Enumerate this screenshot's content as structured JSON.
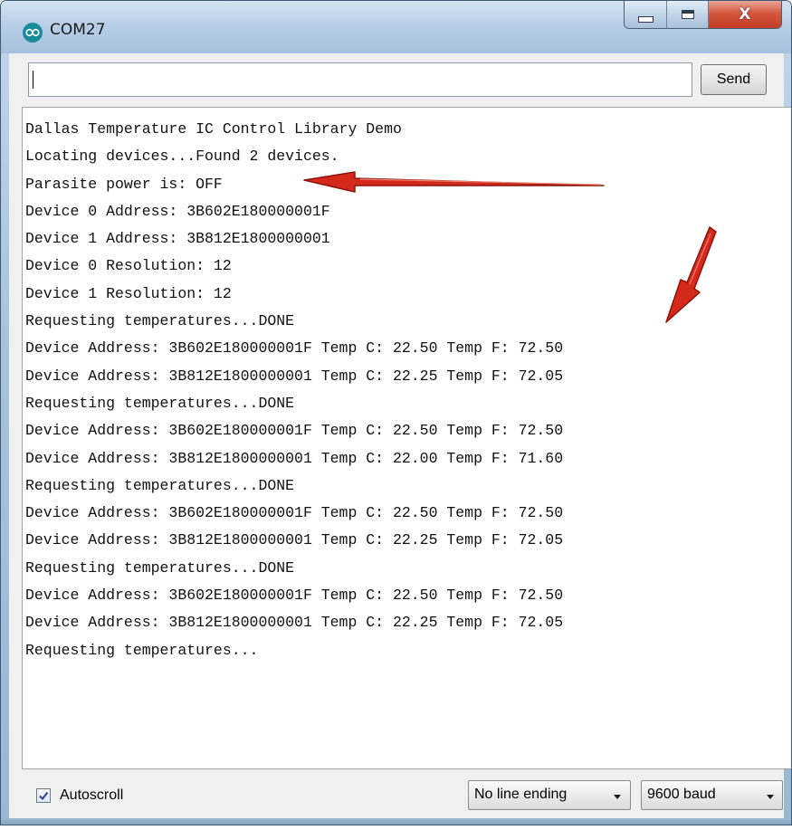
{
  "window": {
    "title": "COM27",
    "icon": "arduino-icon",
    "controls": {
      "minimize": "minimize-icon",
      "maximize": "maximize-icon",
      "close_glyph": "X"
    }
  },
  "toolbar": {
    "input_value": "",
    "input_placeholder": "",
    "send_label": "Send"
  },
  "output": {
    "lines": [
      "Dallas Temperature IC Control Library Demo",
      "Locating devices...Found 2 devices.",
      "Parasite power is: OFF",
      "Device 0 Address: 3B602E180000001F",
      "Device 1 Address: 3B812E1800000001",
      "Device 0 Resolution: 12",
      "Device 1 Resolution: 12",
      "Requesting temperatures...DONE",
      "Device Address: 3B602E180000001F Temp C: 22.50 Temp F: 72.50",
      "Device Address: 3B812E1800000001 Temp C: 22.25 Temp F: 72.05",
      "Requesting temperatures...DONE",
      "Device Address: 3B602E180000001F Temp C: 22.50 Temp F: 72.50",
      "Device Address: 3B812E1800000001 Temp C: 22.00 Temp F: 71.60",
      "Requesting temperatures...DONE",
      "Device Address: 3B602E180000001F Temp C: 22.50 Temp F: 72.50",
      "Device Address: 3B812E1800000001 Temp C: 22.25 Temp F: 72.05",
      "Requesting temperatures...DONE",
      "Device Address: 3B602E180000001F Temp C: 22.50 Temp F: 72.50",
      "Device Address: 3B812E1800000001 Temp C: 22.25 Temp F: 72.05",
      "Requesting temperatures..."
    ]
  },
  "annotations": {
    "arrow_color": "#d42a1c",
    "arrows": [
      "red-arrow-icon",
      "red-arrow-icon"
    ]
  },
  "footer": {
    "autoscroll_label": "Autoscroll",
    "autoscroll_checked": true,
    "line_ending_value": "No line ending",
    "baud_value": "9600 baud"
  }
}
